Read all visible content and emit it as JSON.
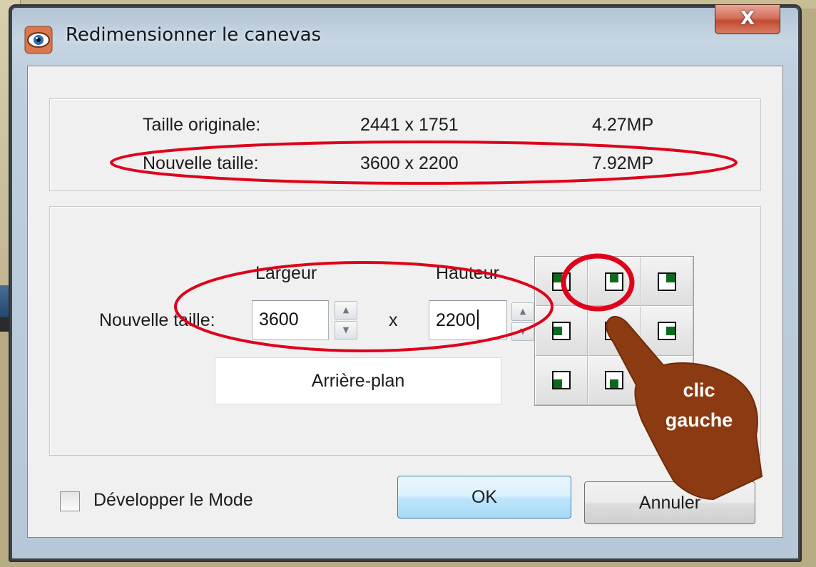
{
  "window": {
    "title": "Redimensionner le canevas",
    "close_label": "X"
  },
  "info": {
    "original_label": "Taille originale:",
    "original_size": "2441 x 1751",
    "original_mp": "4.27MP",
    "new_label": "Nouvelle taille:",
    "new_size": "3600 x 2200",
    "new_mp": "7.92MP"
  },
  "resize": {
    "width_header": "Largeur",
    "height_header": "Hauteur",
    "row_label": "Nouvelle taille:",
    "width_value": "3600",
    "separator": "x",
    "height_value": "2200",
    "background_button": "Arrière-plan"
  },
  "anchor": {
    "selected": "top-left",
    "cells": [
      "top-left",
      "top-center",
      "top-right",
      "middle-left",
      "middle-center",
      "middle-right",
      "bottom-left",
      "bottom-center",
      "bottom-right"
    ]
  },
  "footer": {
    "checkbox_label": "Développer le Mode",
    "checkbox_checked": false,
    "ok_label": "OK",
    "cancel_label": "Annuler"
  },
  "annotation": {
    "line1": "clic",
    "line2": "gauche",
    "highlight_color": "#e0001a",
    "pointer_color": "#8b3a12"
  }
}
